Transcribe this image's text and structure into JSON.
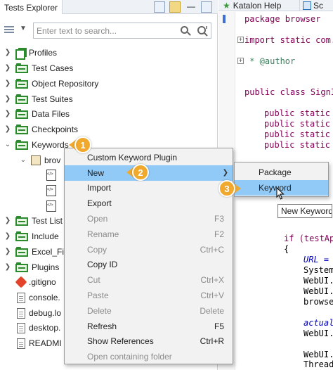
{
  "explorer": {
    "tab_title": "Tests Explorer",
    "search_placeholder": "Enter text to search...",
    "tree": [
      {
        "label": "Profiles"
      },
      {
        "label": "Test Cases"
      },
      {
        "label": "Object Repository"
      },
      {
        "label": "Test Suites"
      },
      {
        "label": "Data Files"
      },
      {
        "label": "Checkpoints"
      },
      {
        "label": "Keywords"
      },
      {
        "label": "brov"
      },
      {
        "label": "Test List"
      },
      {
        "label": "Include"
      },
      {
        "label": "Excel_Fi"
      },
      {
        "label": "Plugins"
      },
      {
        "label": ".gitigno"
      },
      {
        "label": "console."
      },
      {
        "label": "debug.lo"
      },
      {
        "label": "desktop."
      },
      {
        "label": "READMI"
      }
    ]
  },
  "editor": {
    "tab_title": "Katalon Help",
    "tab2_title": "Sc",
    "lines": [
      "package browser",
      "import static com.",
      " * @author",
      "public class SignI",
      "public static",
      "public static",
      "public static",
      "public static",
      "if (testAp",
      "{",
      "URL =",
      "System",
      "WebUI.",
      "WebUI.",
      "browse",
      "actual",
      "WebUI.",
      "WebUI.",
      "Thread"
    ]
  },
  "context_menu": {
    "items": [
      {
        "label": "Custom Keyword Plugin",
        "shortcut": "",
        "disabled": false
      },
      {
        "label": "New",
        "shortcut": "",
        "disabled": false,
        "submenu": true
      },
      {
        "label": "Import",
        "shortcut": "",
        "disabled": false
      },
      {
        "label": "Export",
        "shortcut": "",
        "disabled": false
      },
      {
        "label": "Open",
        "shortcut": "F3",
        "disabled": true
      },
      {
        "label": "Rename",
        "shortcut": "F2",
        "disabled": true
      },
      {
        "label": "Copy",
        "shortcut": "Ctrl+C",
        "disabled": true
      },
      {
        "label": "Copy ID",
        "shortcut": "",
        "disabled": false
      },
      {
        "label": "Cut",
        "shortcut": "Ctrl+X",
        "disabled": true
      },
      {
        "label": "Paste",
        "shortcut": "Ctrl+V",
        "disabled": true
      },
      {
        "label": "Delete",
        "shortcut": "Delete",
        "disabled": true
      },
      {
        "label": "Refresh",
        "shortcut": "F5",
        "disabled": false
      },
      {
        "label": "Show References",
        "shortcut": "Ctrl+R",
        "disabled": false
      },
      {
        "label": "Open containing folder",
        "shortcut": "",
        "disabled": true
      }
    ]
  },
  "submenu": {
    "items": [
      {
        "label": "Package"
      },
      {
        "label": "Keyword"
      }
    ]
  },
  "tooltip": "New Keyword",
  "badges": [
    "1",
    "2",
    "3"
  ],
  "colors": {
    "accent_badge": "#f0a92c",
    "menu_highlight": "#91c9f7",
    "folder_green": "#2b8a2b"
  }
}
